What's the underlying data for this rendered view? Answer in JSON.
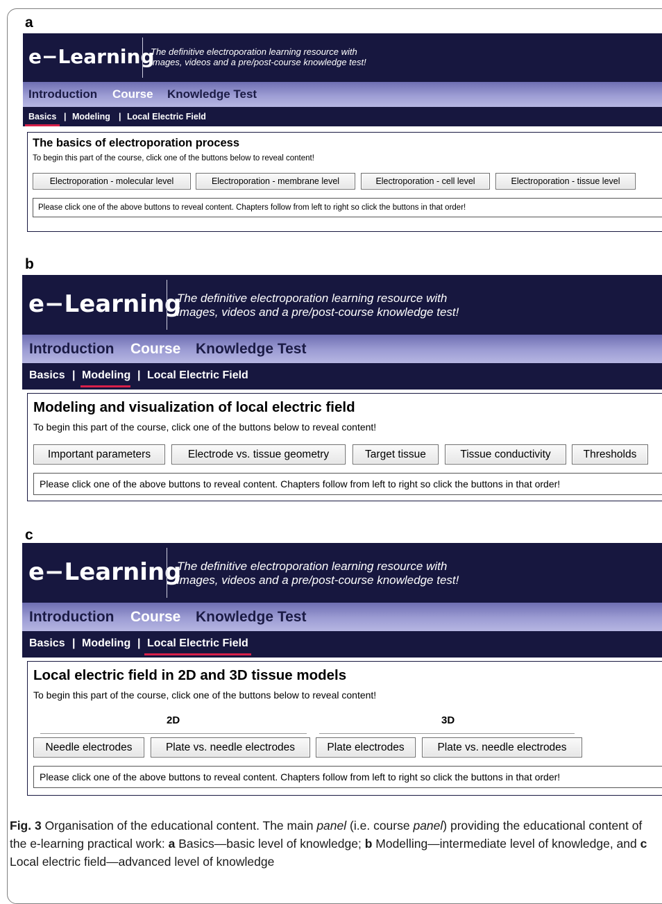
{
  "panels": {
    "a": {
      "letter": "a",
      "logo": "e−Learning",
      "tagline_line1": "The definitive electroporation learning resource with",
      "tagline_line2": "images, videos and a pre/post-course knowledge test!",
      "nav": [
        "Introduction",
        "Course",
        "Knowledge Test"
      ],
      "subnav": [
        "Basics",
        "|",
        "Modeling",
        "|",
        "Local Electric Field"
      ],
      "title": "The basics of electroporation process",
      "intro": "To begin this part of the course, click one of the buttons below to reveal content!",
      "buttons": [
        "Electroporation - molecular level",
        "Electroporation - membrane level",
        "Electroporation - cell level",
        "Electroporation - tissue level"
      ],
      "message": "Please click one of the above buttons to reveal content. Chapters follow from left to right so click the buttons in that order!"
    },
    "b": {
      "letter": "b",
      "logo": "e−Learning",
      "tagline_line1": "The definitive electroporation learning resource with",
      "tagline_line2": "images, videos and a pre/post-course knowledge test!",
      "nav": [
        "Introduction",
        "Course",
        "Knowledge Test"
      ],
      "subnav": [
        "Basics",
        "|",
        "Modeling",
        "|",
        "Local Electric Field"
      ],
      "title": "Modeling and visualization of local electric field",
      "intro": "To begin this part of the course, click one of the buttons below to reveal content!",
      "buttons": [
        "Important parameters",
        "Electrode vs. tissue geometry",
        "Target tissue",
        "Tissue conductivity",
        "Thresholds"
      ],
      "message": "Please click one of the above buttons to reveal content. Chapters follow from left to right so click the buttons in that order!"
    },
    "c": {
      "letter": "c",
      "logo": "e−Learning",
      "tagline_line1": "The definitive electroporation learning resource with",
      "tagline_line2": "images, videos and a pre/post-course knowledge test!",
      "nav": [
        "Introduction",
        "Course",
        "Knowledge Test"
      ],
      "subnav": [
        "Basics",
        "|",
        "Modeling",
        "|",
        "Local Electric Field"
      ],
      "title": "Local electric field in 2D and 3D tissue models",
      "intro": "To begin this part of the course, click one of the buttons below to reveal content!",
      "group_2d": "2D",
      "group_3d": "3D",
      "buttons": [
        "Needle electrodes",
        "Plate vs. needle electrodes",
        "Plate electrodes",
        "Plate vs. needle electrodes"
      ],
      "message": "Please click one of the above buttons to reveal content. Chapters follow from left to right so click the buttons in that order!"
    }
  },
  "caption": {
    "label": "Fig. 3",
    "t1": "Organisation of the educational content. The main",
    "i1": "panel",
    "t2": "(i.e. course",
    "i2": "panel",
    "t3": ") providing the educational content of the e-learning practical work:",
    "a": "a",
    "ta": "Basics—basic level of knowledge;",
    "b": "b",
    "tb": "Modelling—intermediate level of knowledge, and",
    "c": "c",
    "tc": "Local electric field—advanced level of knowledge"
  },
  "colors": {
    "header_bg": "#17173f",
    "nav_gradient_start": "#6f6fb2",
    "nav_gradient_end": "#b6b6e2",
    "active_underline": "#d8204a"
  }
}
